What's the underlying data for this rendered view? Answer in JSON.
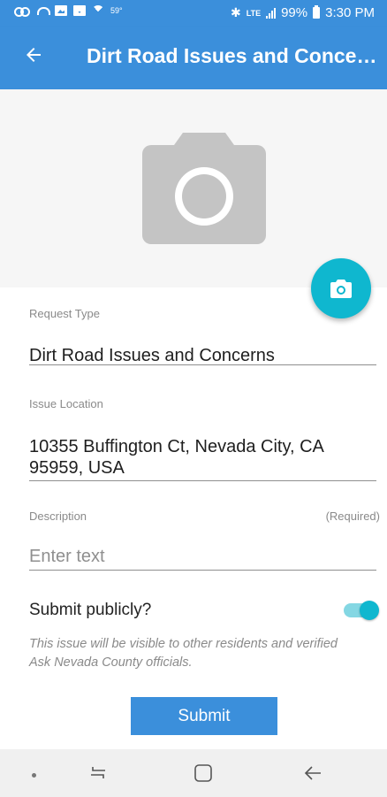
{
  "status_bar": {
    "temperature": "59°",
    "network": "LTE",
    "battery": "99%",
    "time": "3:30 PM",
    "icons": [
      "voicemail-icon",
      "missed-call-icon",
      "image-icon",
      "mail-icon",
      "wifi-icon",
      "bluetooth-icon",
      "signal-icon",
      "battery-icon"
    ]
  },
  "app_bar": {
    "title": "Dirt Road Issues and Concerns",
    "back_icon": "arrow-left-icon"
  },
  "photo": {
    "placeholder_icon": "camera-icon",
    "fab_icon": "camera-icon"
  },
  "form": {
    "request_type": {
      "label": "Request Type",
      "value": "Dirt Road Issues and Concerns"
    },
    "issue_location": {
      "label": "Issue Location",
      "value": "10355 Buffington Ct, Nevada City, CA 95959, USA"
    },
    "description": {
      "label": "Description",
      "required_text": "(Required)",
      "placeholder": "Enter text"
    },
    "submit_publicly": {
      "label": "Submit publicly?",
      "checked": true,
      "notice": "This issue will be visible to other residents and verified Ask Nevada County officials."
    },
    "submit_label": "Submit"
  },
  "nav_bar": {
    "icons": [
      "dot-icon",
      "recents-icon",
      "home-icon",
      "back-icon"
    ]
  },
  "colors": {
    "primary": "#3b8fdb",
    "accent": "#0fb7cf",
    "placeholder_gray": "#c4c4c4"
  }
}
